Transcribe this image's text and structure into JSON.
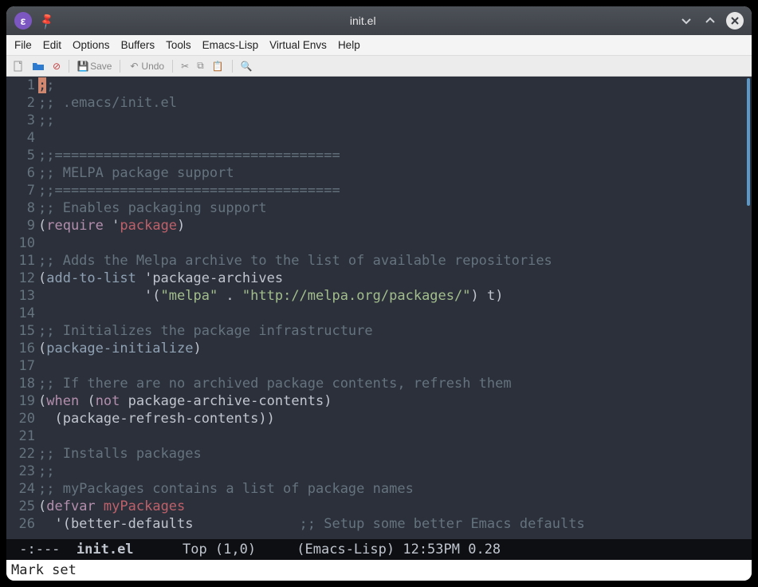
{
  "window": {
    "title": "init.el",
    "app_icon_letter": "ε"
  },
  "menubar": [
    "File",
    "Edit",
    "Options",
    "Buffers",
    "Tools",
    "Emacs-Lisp",
    "Virtual Envs",
    "Help"
  ],
  "toolbar": {
    "save": "Save",
    "undo": "Undo"
  },
  "editor": {
    "lines": [
      {
        "n": 1,
        "tokens": [
          {
            "t": ";",
            "c": "cursor"
          },
          {
            "t": ";",
            "c": "comment"
          }
        ]
      },
      {
        "n": 2,
        "tokens": [
          {
            "t": ";; .emacs/init.el",
            "c": "comment"
          }
        ]
      },
      {
        "n": 3,
        "tokens": [
          {
            "t": ";;",
            "c": "comment"
          }
        ]
      },
      {
        "n": 4,
        "tokens": []
      },
      {
        "n": 5,
        "tokens": [
          {
            "t": ";;===================================",
            "c": "comment"
          }
        ]
      },
      {
        "n": 6,
        "tokens": [
          {
            "t": ";; MELPA package support",
            "c": "comment"
          }
        ]
      },
      {
        "n": 7,
        "tokens": [
          {
            "t": ";;===================================",
            "c": "comment"
          }
        ]
      },
      {
        "n": 8,
        "tokens": [
          {
            "t": ";; Enables packaging support",
            "c": "comment"
          }
        ]
      },
      {
        "n": 9,
        "tokens": [
          {
            "t": "(",
            "c": "paren"
          },
          {
            "t": "require",
            "c": "keyword"
          },
          {
            "t": " '",
            "c": "paren"
          },
          {
            "t": "package",
            "c": "symbol"
          },
          {
            "t": ")",
            "c": "paren"
          }
        ]
      },
      {
        "n": 10,
        "tokens": []
      },
      {
        "n": 11,
        "tokens": [
          {
            "t": ";; Adds the Melpa archive to the list of available repositories",
            "c": "comment"
          }
        ]
      },
      {
        "n": 12,
        "tokens": [
          {
            "t": "(",
            "c": "paren"
          },
          {
            "t": "add-to-list",
            "c": "fname"
          },
          {
            "t": " 'package-archives",
            "c": "paren"
          }
        ]
      },
      {
        "n": 13,
        "tokens": [
          {
            "t": "             '(",
            "c": "paren"
          },
          {
            "t": "\"melpa\"",
            "c": "string"
          },
          {
            "t": " . ",
            "c": "paren"
          },
          {
            "t": "\"http://melpa.org/packages/\"",
            "c": "string"
          },
          {
            "t": ") t)",
            "c": "paren"
          }
        ]
      },
      {
        "n": 14,
        "tokens": []
      },
      {
        "n": 15,
        "tokens": [
          {
            "t": ";; Initializes the package infrastructure",
            "c": "comment"
          }
        ]
      },
      {
        "n": 16,
        "tokens": [
          {
            "t": "(",
            "c": "paren"
          },
          {
            "t": "package-initialize",
            "c": "fname"
          },
          {
            "t": ")",
            "c": "paren"
          }
        ]
      },
      {
        "n": 17,
        "tokens": []
      },
      {
        "n": 18,
        "tokens": [
          {
            "t": ";; If there are no archived package contents, refresh them",
            "c": "comment"
          }
        ]
      },
      {
        "n": 19,
        "tokens": [
          {
            "t": "(",
            "c": "paren"
          },
          {
            "t": "when",
            "c": "keyword"
          },
          {
            "t": " (",
            "c": "paren"
          },
          {
            "t": "not",
            "c": "keyword"
          },
          {
            "t": " package-archive-contents)",
            "c": "paren"
          }
        ]
      },
      {
        "n": 20,
        "tokens": [
          {
            "t": "  (package-refresh-contents))",
            "c": "paren"
          }
        ]
      },
      {
        "n": 21,
        "tokens": []
      },
      {
        "n": 22,
        "tokens": [
          {
            "t": ";; Installs packages",
            "c": "comment"
          }
        ]
      },
      {
        "n": 23,
        "tokens": [
          {
            "t": ";;",
            "c": "comment"
          }
        ]
      },
      {
        "n": 24,
        "tokens": [
          {
            "t": ";; myPackages contains a list of package names",
            "c": "comment"
          }
        ]
      },
      {
        "n": 25,
        "tokens": [
          {
            "t": "(",
            "c": "paren"
          },
          {
            "t": "defvar",
            "c": "keyword"
          },
          {
            "t": " ",
            "c": "paren"
          },
          {
            "t": "myPackages",
            "c": "symbol"
          }
        ]
      },
      {
        "n": 26,
        "tokens": [
          {
            "t": "  '(better-defaults             ",
            "c": "paren"
          },
          {
            "t": ";; Setup some better Emacs defaults",
            "c": "comment"
          }
        ]
      }
    ]
  },
  "modeline": {
    "left": " -:--- ",
    "file": " init.el",
    "pad1": "      ",
    "pos": "Top (1,0)",
    "pad2": "     ",
    "mode": "(Emacs-Lisp)",
    "time": " 12:53PM 0.28"
  },
  "minibuffer": "Mark set"
}
